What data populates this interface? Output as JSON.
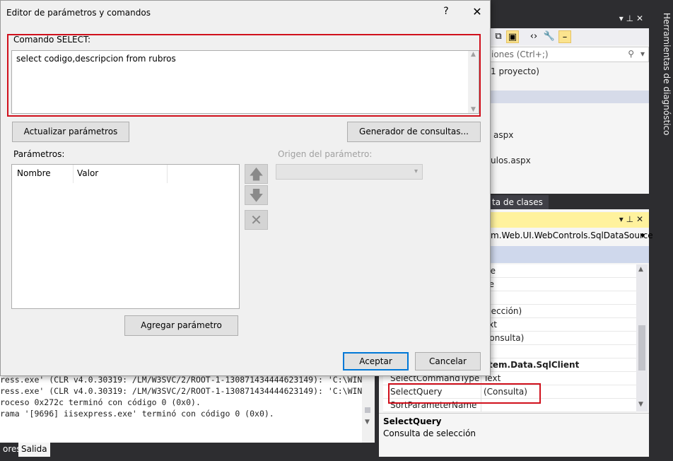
{
  "dialog": {
    "title": "Editor de parámetros y comandos",
    "help": "?",
    "close": "✕",
    "select_label": "Comando SELECT:",
    "select_text": "select codigo,descripcion from rubros",
    "refresh_button": "Actualizar parámetros",
    "query_builder_button": "Generador de consultas...",
    "params_label": "Parámetros:",
    "col_name": "Nombre",
    "col_value": "Valor",
    "source_label": "Origen del parámetro:",
    "add_param_button": "Agregar parámetro",
    "ok_button": "Aceptar",
    "cancel_button": "Cancelar"
  },
  "right_tab": "Herramientas de diagnóstico",
  "solution_explorer": {
    "search_placeholder": "iones (Ctrl+;)",
    "items": [
      "1 proyecto)",
      "aspx",
      "ulos.aspx"
    ],
    "bottom_tabs": [
      "ta de clases"
    ]
  },
  "properties": {
    "object": "m.Web.UI.WebControls.SqlDataSource",
    "rows": [
      {
        "name": "",
        "value": "lse",
        "bold": false
      },
      {
        "name": "",
        "value": "ue",
        "bold": false
      },
      {
        "name": "",
        "value": "",
        "bold": false
      },
      {
        "name": "",
        "value": "olección)",
        "bold": false
      },
      {
        "name": "",
        "value": "ext",
        "bold": false
      },
      {
        "name": "",
        "value": "Consulta)",
        "bold": false
      },
      {
        "name": "",
        "value": "",
        "bold": false
      },
      {
        "name": "",
        "value": "stem.Data.SqlClient",
        "bold": true
      },
      {
        "name": "SelectCommandType",
        "value": "Text",
        "bold": false
      },
      {
        "name": "SelectQuery",
        "value": "(Consulta)",
        "bold": false
      },
      {
        "name": "SortParameterName",
        "value": "",
        "bold": false
      }
    ],
    "desc_title": "SelectQuery",
    "desc_text": "Consulta de selección"
  },
  "output": {
    "lines": [
      "ress.exe' (CLR v4.0.30319: /LM/W3SVC/2/ROOT-1-130871434444623149): 'C:\\WIN",
      "ress.exe' (CLR v4.0.30319: /LM/W3SVC/2/ROOT-1-130871434444623149): 'C:\\WIN",
      "roceso 0x272c terminó con código 0 (0x0).",
      "rama '[9696] iisexpress.exe' terminó con código 0 (0x0)."
    ],
    "tabs": [
      "ores",
      "Salida"
    ]
  }
}
